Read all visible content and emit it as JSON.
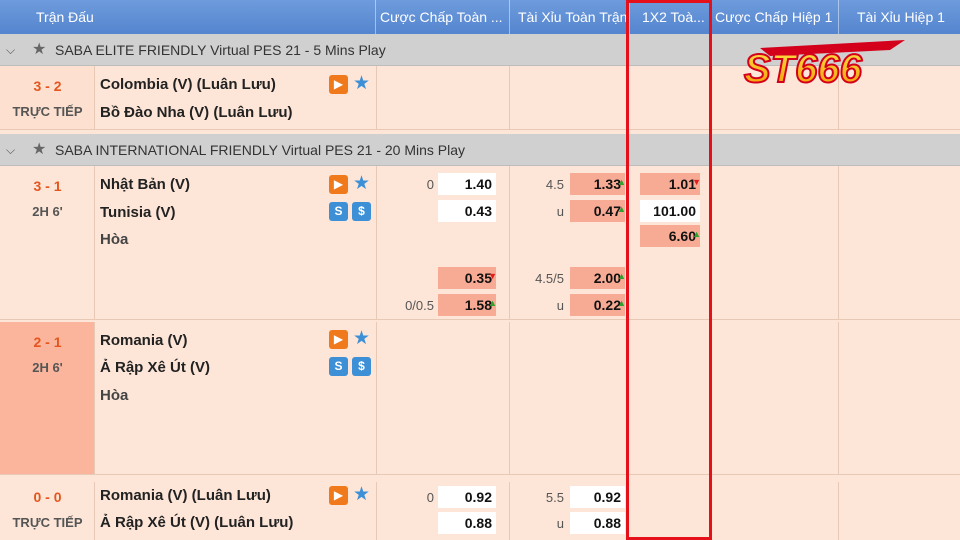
{
  "header": {
    "col_match": "Trận Đấu",
    "col_handicap_full": "Cược Chấp Toàn ...",
    "col_ou_full": "Tài Xỉu Toàn Trận",
    "col_1x2_full": "1X2 Toà...",
    "col_handicap_half": "Cược Chấp Hiệp 1",
    "col_ou_half": "Tài Xỉu Hiệp 1"
  },
  "logo": {
    "text": "ST666",
    "colors": {
      "primary": "#f6b800",
      "outline": "#d4001b"
    }
  },
  "leagues": [
    {
      "name": "SABA ELITE FRIENDLY Virtual PES 21 - 5 Mins Play"
    },
    {
      "name": "SABA INTERNATIONAL FRIENDLY Virtual PES 21 - 20 Mins Play"
    }
  ],
  "matches": [
    {
      "score": "3 - 2",
      "status": "TRỰC TIẾP",
      "home": "Colombia (V) (Luân Lưu)",
      "away": "Bồ Đào Nha (V) (Luân Lưu)"
    },
    {
      "score": "3 - 1",
      "status": "2H 6'",
      "home": "Nhật Bản (V)",
      "away": "Tunisia (V)",
      "draw": "Hòa",
      "hdp1": "0",
      "hdp1_home": "1.40",
      "hdp1_away": "0.43",
      "ou1": "4.5",
      "ou1_over": "1.33",
      "ou1_under_label": "u",
      "ou1_under": "0.47",
      "x12_home": "1.01",
      "x12_away": "101.00",
      "x12_draw": "6.60",
      "hdp2_home": "0.35",
      "hdp2": "0/0.5",
      "hdp2_away": "1.58",
      "ou2": "4.5/5",
      "ou2_over": "2.00",
      "ou2_under_label": "u",
      "ou2_under": "0.22"
    },
    {
      "score": "2 - 1",
      "status": "2H 6'",
      "home": "Romania (V)",
      "away": "Ả Rập Xê Út (V)",
      "draw": "Hòa"
    },
    {
      "score": "0 - 0",
      "status": "TRỰC TIẾP",
      "home": "Romania (V) (Luân Lưu)",
      "away": "Ả Rập Xê Út (V) (Luân Lưu)",
      "hdp1": "0",
      "hdp1_home": "0.92",
      "hdp1_away": "0.88",
      "ou1": "5.5",
      "ou1_over": "0.92",
      "ou1_under_label": "u",
      "ou1_under": "0.88"
    }
  ],
  "icons": {
    "play": "▶",
    "favorite": "★",
    "stats": "S",
    "money": "$",
    "collapse": "chevron-down-icon",
    "league_star": "★"
  },
  "colors": {
    "header": "#5f8fd5",
    "row": "#fde6d8",
    "highlight": "#f8ab94",
    "score": "#e4561e",
    "redbox": "#e5101a"
  }
}
